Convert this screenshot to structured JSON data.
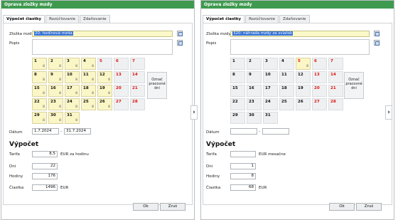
{
  "left": {
    "title": "Oprava zložky mzdy",
    "tabs": [
      "Výpočet čiastky",
      "Rozúčtovanie",
      "Zdaňovanie"
    ],
    "labels": {
      "zlozka": "Zložka mzdy",
      "popis": "Popis",
      "datum": "Dátum",
      "tarifa": "Tarifa",
      "dni": "Dni",
      "hodiny": "Hodiny",
      "ciastka": "Čiastka"
    },
    "zlozka_value": "20: hodinová mzda",
    "mark_button": "Označ pracovné dni",
    "date_from": "1.7.2024",
    "date_sep": "-",
    "date_to": "31.7.2024",
    "section_title": "Výpočet",
    "tarifa": "8,5",
    "tarifa_unit": "EUR za hodinu",
    "dni": "22",
    "hodiny": "176",
    "ciastka": "1496",
    "ciastka_unit": "EUR",
    "ok": "Ok",
    "cancel": "Zruš",
    "days": [
      {
        "d": "1",
        "h": "8",
        "w": true
      },
      {
        "d": "2",
        "h": "8",
        "w": true
      },
      {
        "d": "3",
        "h": "8",
        "w": true
      },
      {
        "d": "4",
        "h": "8",
        "w": true
      },
      {
        "d": "5",
        "h": "",
        "w": false,
        "r": true
      },
      {
        "d": "6",
        "h": "",
        "w": false,
        "r": true
      },
      {
        "d": "7",
        "h": "",
        "w": false,
        "r": true
      },
      {
        "d": "8",
        "h": "8",
        "w": true
      },
      {
        "d": "9",
        "h": "8",
        "w": true
      },
      {
        "d": "10",
        "h": "8",
        "w": true
      },
      {
        "d": "11",
        "h": "8",
        "w": true
      },
      {
        "d": "12",
        "h": "8",
        "w": true
      },
      {
        "d": "13",
        "h": "",
        "w": false,
        "r": true
      },
      {
        "d": "14",
        "h": "",
        "w": false,
        "r": true
      },
      {
        "d": "15",
        "h": "8",
        "w": true
      },
      {
        "d": "16",
        "h": "8",
        "w": true
      },
      {
        "d": "17",
        "h": "8",
        "w": true
      },
      {
        "d": "18",
        "h": "8",
        "w": true
      },
      {
        "d": "19",
        "h": "8",
        "w": true
      },
      {
        "d": "20",
        "h": "",
        "w": false,
        "r": true
      },
      {
        "d": "21",
        "h": "",
        "w": false,
        "r": true
      },
      {
        "d": "22",
        "h": "8",
        "w": true
      },
      {
        "d": "23",
        "h": "8",
        "w": true
      },
      {
        "d": "24",
        "h": "8",
        "w": true
      },
      {
        "d": "25",
        "h": "8",
        "w": true
      },
      {
        "d": "26",
        "h": "8",
        "w": true
      },
      {
        "d": "27",
        "h": "",
        "w": false,
        "r": true
      },
      {
        "d": "28",
        "h": "",
        "w": false,
        "r": true
      },
      {
        "d": "29",
        "h": "8",
        "w": true
      },
      {
        "d": "30",
        "h": "8",
        "w": true
      },
      {
        "d": "31",
        "h": "8",
        "w": true
      }
    ]
  },
  "right": {
    "title": "Oprava zložky mzdy",
    "tabs": [
      "Výpočet čiastky",
      "Rozúčtovanie",
      "Zdaňovanie"
    ],
    "labels": {
      "zlozka": "Zložka mzdy",
      "popis": "Popis",
      "datum": "Dátum",
      "tarifa": "Tarifa",
      "dni": "Dni",
      "hodiny": "Hodiny",
      "ciastka": "Čiastka"
    },
    "zlozka_value": "320: náhrada mzdy za sviatok",
    "mark_button": "Označ pracovné dni",
    "date_from": "",
    "date_sep": "-",
    "date_to": "",
    "section_title": "Výpočet",
    "tarifa": "",
    "tarifa_unit": "EUR mesačne",
    "dni": "1",
    "hodiny": "8",
    "ciastka": "68",
    "ciastka_unit": "EUR",
    "ok": "Ok",
    "cancel": "Zruš",
    "days": [
      {
        "d": "1"
      },
      {
        "d": "2"
      },
      {
        "d": "3"
      },
      {
        "d": "4"
      },
      {
        "d": "5",
        "h": "8",
        "w": true,
        "r": true
      },
      {
        "d": "6",
        "r": true
      },
      {
        "d": "7",
        "r": true
      },
      {
        "d": "8"
      },
      {
        "d": "9"
      },
      {
        "d": "10"
      },
      {
        "d": "11"
      },
      {
        "d": "12"
      },
      {
        "d": "13",
        "r": true
      },
      {
        "d": "14",
        "r": true
      },
      {
        "d": "15"
      },
      {
        "d": "16"
      },
      {
        "d": "17"
      },
      {
        "d": "18"
      },
      {
        "d": "19"
      },
      {
        "d": "20",
        "r": true
      },
      {
        "d": "21",
        "r": true
      },
      {
        "d": "22"
      },
      {
        "d": "23"
      },
      {
        "d": "24"
      },
      {
        "d": "25"
      },
      {
        "d": "26"
      },
      {
        "d": "27",
        "r": true
      },
      {
        "d": "28",
        "r": true
      },
      {
        "d": "29"
      },
      {
        "d": "30"
      },
      {
        "d": "31"
      }
    ]
  },
  "nav_arrow": "›"
}
